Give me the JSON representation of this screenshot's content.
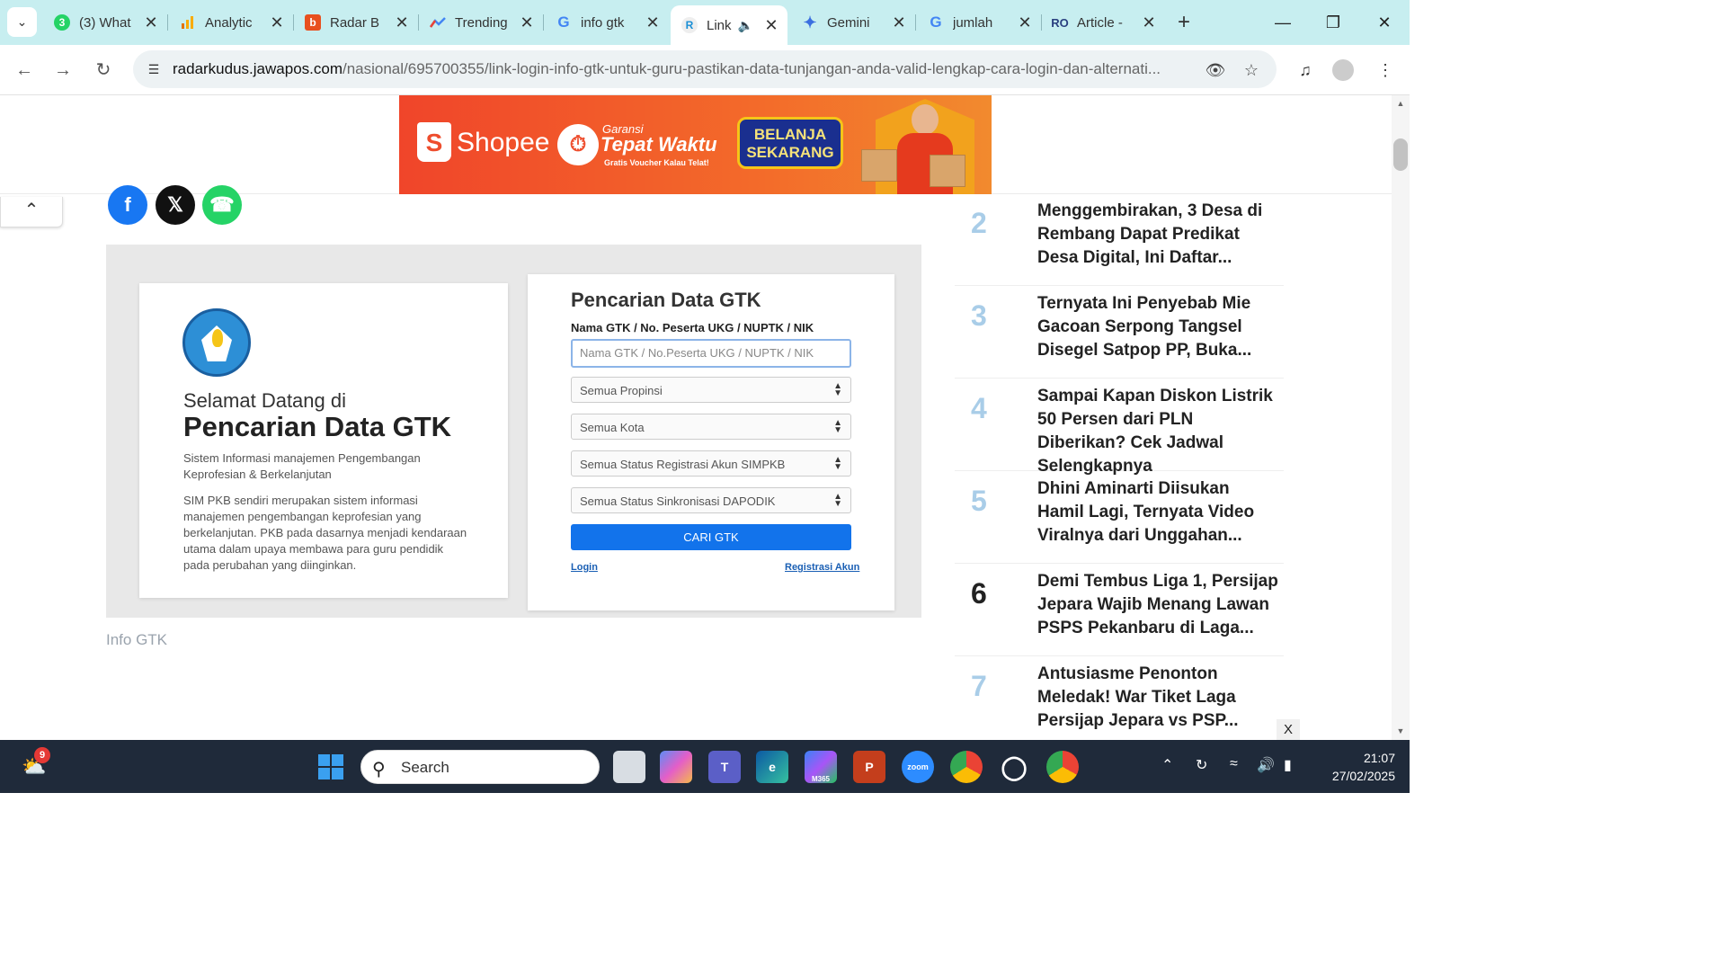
{
  "browser": {
    "tabs": [
      {
        "title": "(3) What",
        "icon": "whatsapp-icon",
        "color": "#25d366",
        "badge": "3"
      },
      {
        "title": "Analytic",
        "icon": "analytics-icon",
        "color": "#f4a300"
      },
      {
        "title": "Radar B",
        "icon": "radar-icon",
        "color": "#e8501f"
      },
      {
        "title": "Trending",
        "icon": "trends-icon",
        "color": "#4285f4"
      },
      {
        "title": "info gtk",
        "icon": "google-icon",
        "color": "#4285f4"
      },
      {
        "title": "Link",
        "icon": "radar-kudus-icon",
        "color": "#1a8fd6",
        "active": true
      },
      {
        "title": "Gemini",
        "icon": "gemini-icon",
        "color": "#3b6fe0"
      },
      {
        "title": "jumlah",
        "icon": "google-icon",
        "color": "#4285f4"
      },
      {
        "title": "Article -",
        "icon": "article-icon",
        "color": "#2a3f7f"
      }
    ],
    "url_domain": "radarkudus.jawapos.com",
    "url_path": "/nasional/695700355/link-login-info-gtk-untuk-guru-pastikan-data-tunjangan-anda-valid-lengkap-cara-login-dan-alternati..."
  },
  "ad": {
    "brand": "Shopee",
    "line1": "Garansi",
    "line2": "Tepat Waktu",
    "line3": "Gratis Voucher Kalau Telat!",
    "cta": "BELANJA SEKARANG"
  },
  "figure": {
    "left_heading_small": "Selamat Datang di",
    "left_heading_big": "Pencarian Data GTK",
    "left_p1": "Sistem Informasi manajemen Pengembangan Keprofesian & Berkelanjutan",
    "left_p2": "SIM PKB sendiri merupakan sistem informasi manajemen pengembangan keprofesian yang berkelanjutan. PKB pada dasarnya menjadi kendaraan utama dalam upaya membawa para guru pendidik pada perubahan yang diinginkan.",
    "form_title": "Pencarian Data GTK",
    "form_label": "Nama GTK / No. Peserta UKG / NUPTK / NIK",
    "form_placeholder": "Nama GTK / No.Peserta UKG / NUPTK / NIK",
    "select_provinsi": "Semua Propinsi",
    "select_kota": "Semua Kota",
    "select_registrasi": "Semua Status Registrasi Akun SIMPKB",
    "select_sinkronisasi": "Semua Status Sinkronisasi DAPODIK",
    "search_button": "CARI GTK",
    "login_link": "Login",
    "register_link": "Registrasi Akun",
    "caption": "Info GTK"
  },
  "trending": [
    {
      "num": "2",
      "title": "Menggembirakan, 3 Desa di Rembang Dapat Predikat Desa Digital, Ini Daftar..."
    },
    {
      "num": "3",
      "title": "Ternyata Ini Penyebab Mie Gacoan Serpong Tangsel Disegel Satpop PP, Buka..."
    },
    {
      "num": "4",
      "title": "Sampai Kapan Diskon Listrik 50 Persen dari PLN Diberikan? Cek Jadwal Selengkapnya"
    },
    {
      "num": "5",
      "title": "Dhini Aminarti Diisukan Hamil Lagi, Ternyata Video Viralnya dari Unggahan..."
    },
    {
      "num": "6",
      "title": "Demi Tembus Liga 1, Persijap Jepara Wajib Menang Lawan PSPS Pekanbaru di Laga..."
    },
    {
      "num": "7",
      "title": "Antusiasme Penonton Meledak! War Tiket Laga Persijap Jepara vs PSP..."
    }
  ],
  "close_ad": "X",
  "taskbar": {
    "search_label": "Search",
    "notification_count": "9",
    "time": "21:07",
    "date": "27/02/2025",
    "zoom_label": "zoom",
    "m365_label": "M365"
  }
}
